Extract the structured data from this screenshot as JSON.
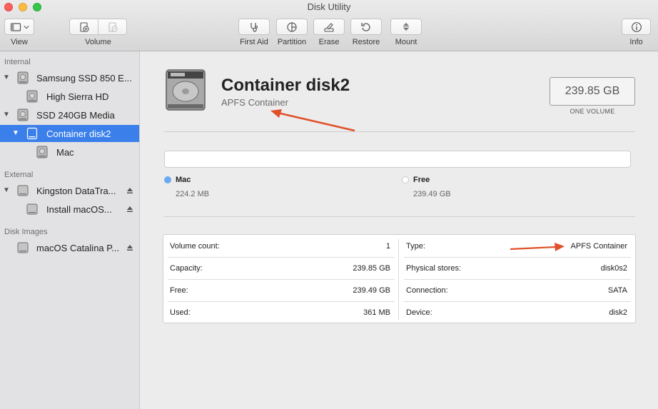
{
  "window": {
    "title": "Disk Utility"
  },
  "toolbar": {
    "view_label": "View",
    "volume_label": "Volume",
    "first_aid_label": "First Aid",
    "partition_label": "Partition",
    "erase_label": "Erase",
    "restore_label": "Restore",
    "mount_label": "Mount",
    "info_label": "Info"
  },
  "sidebar": {
    "sections": {
      "internal": "Internal",
      "external": "External",
      "disk_images": "Disk Images"
    },
    "items": [
      {
        "label": "Samsung SSD 850 E...",
        "icon": "hdd-icon"
      },
      {
        "label": "High Sierra HD",
        "icon": "hdd-icon"
      },
      {
        "label": "SSD 240GB Media",
        "icon": "hdd-icon"
      },
      {
        "label": "Container disk2",
        "icon": "container-icon",
        "selected": true
      },
      {
        "label": "Mac",
        "icon": "hdd-icon"
      },
      {
        "label": "Kingston DataTra...",
        "icon": "external-drive-icon"
      },
      {
        "label": "Install macOS...",
        "icon": "external-drive-icon"
      },
      {
        "label": "macOS Catalina P...",
        "icon": "disk-image-icon"
      }
    ]
  },
  "main": {
    "title": "Container disk2",
    "subtitle": "APFS Container",
    "size": "239.85 GB",
    "size_caption": "ONE VOLUME",
    "legend": [
      {
        "name": "Mac",
        "value": "224.2 MB",
        "color": "#6aaaf0"
      },
      {
        "name": "Free",
        "value": "239.49 GB",
        "color": "#ffffff"
      }
    ],
    "info_left": [
      {
        "key": "Volume count:",
        "value": "1"
      },
      {
        "key": "Capacity:",
        "value": "239.85 GB"
      },
      {
        "key": "Free:",
        "value": "239.49 GB"
      },
      {
        "key": "Used:",
        "value": "361 MB"
      }
    ],
    "info_right": [
      {
        "key": "Type:",
        "value": "APFS Container"
      },
      {
        "key": "Physical stores:",
        "value": "disk0s2"
      },
      {
        "key": "Connection:",
        "value": "SATA"
      },
      {
        "key": "Device:",
        "value": "disk2"
      }
    ]
  },
  "colors": {
    "selection": "#3b80ea",
    "annotation_arrow": "#e0502a"
  }
}
